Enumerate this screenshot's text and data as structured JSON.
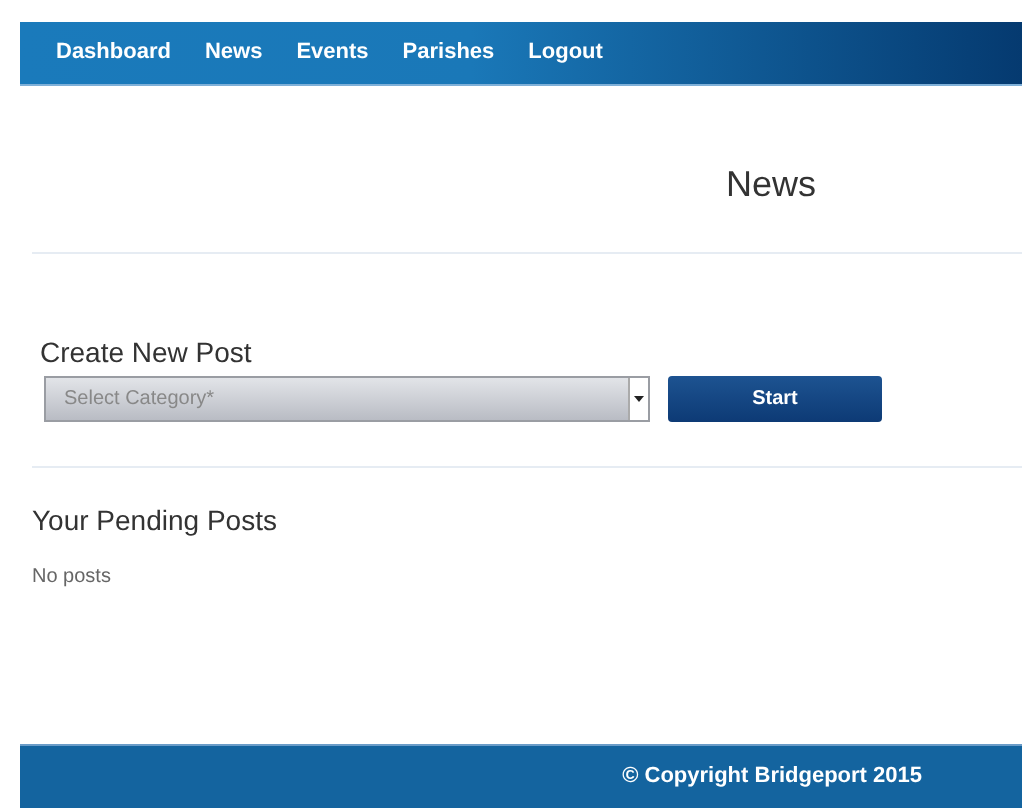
{
  "nav": {
    "items": [
      {
        "label": "Dashboard"
      },
      {
        "label": "News"
      },
      {
        "label": "Events"
      },
      {
        "label": "Parishes"
      },
      {
        "label": "Logout"
      }
    ]
  },
  "page_title": "News",
  "create_post": {
    "heading": "Create New Post",
    "category_select": {
      "placeholder": "Select Category*"
    },
    "button": "Start"
  },
  "pending_posts": {
    "heading": "Your Pending Posts",
    "empty_text": "No posts"
  },
  "footer": {
    "text": "© Copyright Bridgeport 2015"
  }
}
